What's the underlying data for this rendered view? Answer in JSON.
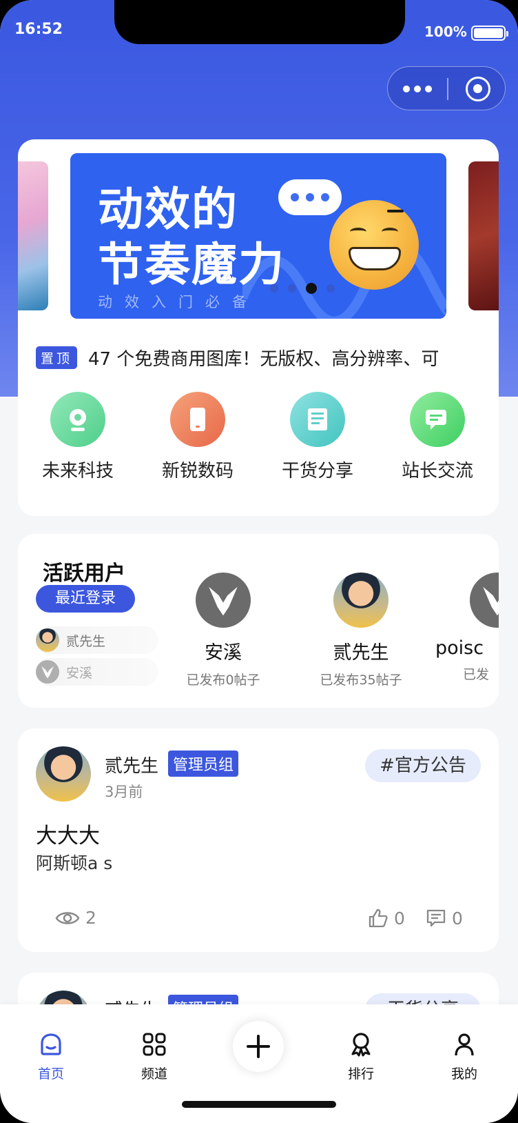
{
  "status_bar": {
    "time": "16:52",
    "battery": "100%"
  },
  "banner": {
    "line1": "动效的",
    "line2": "节奏魔力",
    "subtitle": "动效入门必备",
    "active_index": 2,
    "count": 4
  },
  "pinned": {
    "badge": "置顶",
    "text": "47 个免费商用图库！无版权、高分辨率、可"
  },
  "channels": [
    {
      "name": "未来科技",
      "icon": "webcam-icon"
    },
    {
      "name": "新锐数码",
      "icon": "phone-icon"
    },
    {
      "name": "干货分享",
      "icon": "document-icon"
    },
    {
      "name": "站长交流",
      "icon": "chat-icon"
    }
  ],
  "active_users": {
    "title": "活跃用户",
    "recent_label": "最近登录",
    "recent": [
      "贰先生",
      "安溪"
    ],
    "users": [
      {
        "name": "安溪",
        "posts": "已发布0帖子"
      },
      {
        "name": "贰先生",
        "posts": "已发布35帖子"
      },
      {
        "name": "poisc",
        "posts": "已发"
      }
    ]
  },
  "posts": [
    {
      "author": "贰先生",
      "role": "管理员组",
      "time": "3月前",
      "tag": "#官方公告",
      "title": "大大大",
      "body": "阿斯顿a s",
      "views": "2",
      "likes": "0",
      "comments": "0"
    },
    {
      "author": "贰先生",
      "role": "管理员组",
      "tag": "干货分享"
    }
  ],
  "tabbar": {
    "home": "首页",
    "channels": "频道",
    "ranking": "排行",
    "me": "我的"
  },
  "colors": {
    "primary": "#3c57de",
    "header": "#3a58e0",
    "page_bg": "#f5f6f8"
  }
}
